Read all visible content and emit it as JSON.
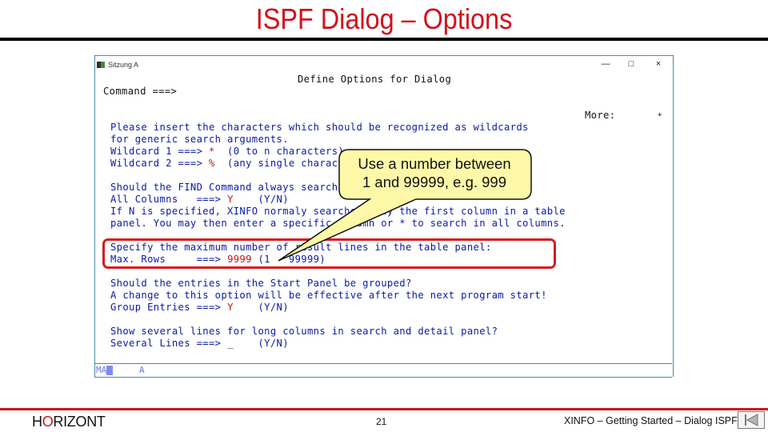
{
  "slide": {
    "title": "ISPF Dialog – Options",
    "logo_prefix": "H",
    "logo_o": "O",
    "logo_suffix": "RIZONT",
    "page_number": "21",
    "footer_text": "XINFO – Getting Started – Dialog ISPF",
    "nav_button_icon": "first-page-icon",
    "accent_color": "#d0121b"
  },
  "window": {
    "title": "Sitzung A",
    "controls": {
      "minimize": "—",
      "maximize": "□",
      "close": "×"
    }
  },
  "terminal": {
    "header": "Define Options for Dialog",
    "command_label": "Command ===>",
    "command_value": "",
    "more_label": "More:",
    "more_indicator": "+",
    "wildcard_intro_1": "Please insert the characters which should be recognized as wildcards",
    "wildcard_intro_2": "for generic search arguments.",
    "wildcard1_label": "Wildcard 1 ===> ",
    "wildcard1_value": "*",
    "wildcard1_hint": "  (0 to n characters)",
    "wildcard2_label": "Wildcard 2 ===> ",
    "wildcard2_value": "%",
    "wildcard2_hint": "  (any single character)",
    "find_question": "Should the FIND Command always search all columns or only the first?",
    "allcols_label": "All Columns   ===> ",
    "allcols_value": "Y",
    "allcols_hint": "    (Y/N)",
    "find_info_1": "If N is specified, XINFO normaly searches only the first column in a table",
    "find_info_2": "panel. You may then enter a specific column or * to search in all columns.",
    "maxrows_question": "Specify the maximum number of result lines in the table panel:",
    "maxrows_label": "Max. Rows     ===> ",
    "maxrows_value": "9999",
    "maxrows_hint": " (1   99999)",
    "group_question": "Should the entries in the Start Panel be grouped?",
    "group_info": "A change to this option will be effective after the next program start!",
    "group_label": "Group Entries ===> ",
    "group_value": "Y",
    "group_hint": "    (Y/N)",
    "several_question": "Show several lines for long columns in search and detail panel?",
    "several_label": "Several Lines ===> ",
    "several_value": "_",
    "several_hint": "    (Y/N)"
  },
  "status_bar": {
    "mode": "MA",
    "session": "A"
  },
  "callout": {
    "line1": "Use a number between",
    "line2": "1 and 99999, e.g. 999"
  }
}
